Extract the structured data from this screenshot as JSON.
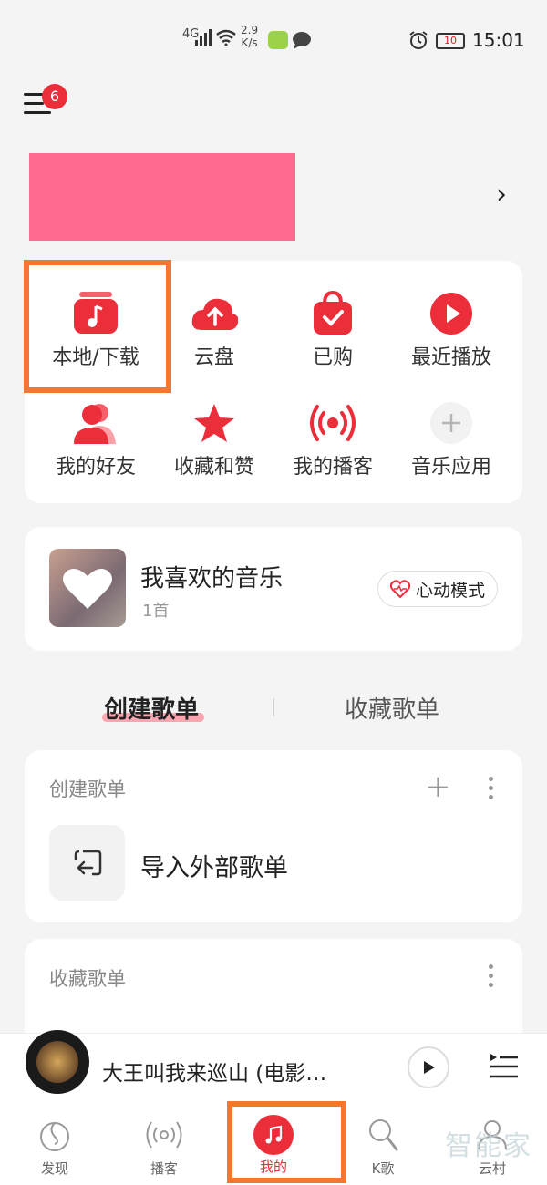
{
  "status_bar": {
    "network": "4G",
    "speed_value": "2.9",
    "speed_unit": "K/s",
    "battery": "10",
    "time": "15:01"
  },
  "header": {
    "notification_count": "6"
  },
  "quick_grid": [
    {
      "label": "本地/下载",
      "icon": "music-folder-icon"
    },
    {
      "label": "云盘",
      "icon": "cloud-upload-icon"
    },
    {
      "label": "已购",
      "icon": "shopping-bag-icon"
    },
    {
      "label": "最近播放",
      "icon": "play-circle-icon"
    },
    {
      "label": "我的好友",
      "icon": "friends-icon"
    },
    {
      "label": "收藏和赞",
      "icon": "star-icon"
    },
    {
      "label": "我的播客",
      "icon": "broadcast-icon"
    },
    {
      "label": "音乐应用",
      "icon": "plus-icon"
    }
  ],
  "favorites": {
    "title": "我喜欢的音乐",
    "count": "1首",
    "heart_mode": "心动模式"
  },
  "playlist_tabs": {
    "active": "创建歌单",
    "inactive": "收藏歌单"
  },
  "created_section": {
    "label": "创建歌单",
    "import_label": "导入外部歌单"
  },
  "collected_section": {
    "label": "收藏歌单"
  },
  "player": {
    "song": "大王叫我来巡山 (电影…"
  },
  "bottom_nav": [
    {
      "label": "发现",
      "icon": "discover-icon"
    },
    {
      "label": "播客",
      "icon": "podcast-icon"
    },
    {
      "label": "我的",
      "icon": "music-note-icon"
    },
    {
      "label": "K歌",
      "icon": "microphone-icon"
    },
    {
      "label": "云村",
      "icon": "community-icon"
    }
  ],
  "watermark": "智能家",
  "colors": {
    "accent": "#ec2d3a",
    "highlight_box": "#f4772f",
    "profile_block": "#ff6b8f"
  }
}
